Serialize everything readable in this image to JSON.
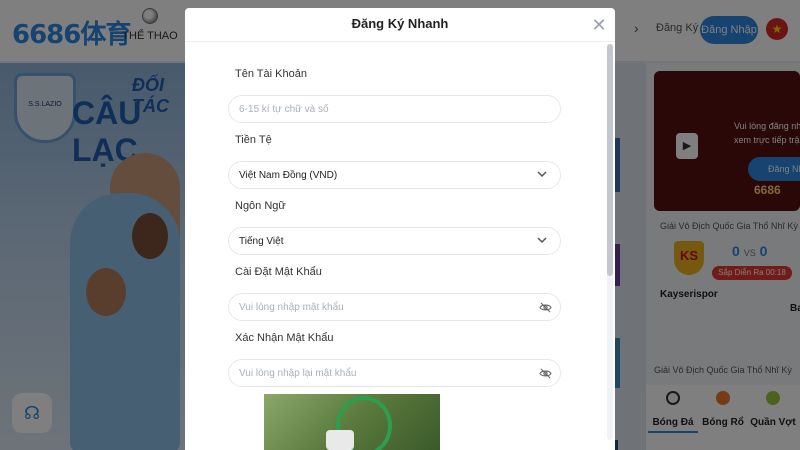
{
  "header": {
    "logo": "6686体育",
    "nav_sports": "THỂ THAO",
    "register": "Đăng Ký",
    "login": "Đăng Nhập",
    "flag_symbol": "★"
  },
  "hero": {
    "crest_label": "S.S.LAZIO",
    "title_line1": "ĐỐI TÁC",
    "title_line2": "CÂU LẠC"
  },
  "right_panel": {
    "promo_message": "Vui lòng đăng nhập xem trực tiếp trận",
    "promo_button": "Đăng Nhập",
    "promo_logo": "6686",
    "league": "Giải Vô Địch Quốc Gia Thổ Nhĩ Kỳ",
    "home_logo": "KS",
    "home_score": "0",
    "vs": "VS",
    "away_score": "0",
    "live_badge": "Sắp Diễn Ra 00:18",
    "home_team": "Kayserispor",
    "away_team": "Ba",
    "league2": "Giải Vô Địch Quốc Gia Thổ Nhĩ Kỳ",
    "tabs": [
      {
        "label": "Bóng Đá",
        "color": "#f4f4f4"
      },
      {
        "label": "Bóng Rổ",
        "color": "#e8782a"
      },
      {
        "label": "Quần Vợt",
        "color": "#9bc53d"
      }
    ]
  },
  "modal": {
    "title": "Đăng Ký Nhanh",
    "close": "✕",
    "fields": {
      "username": {
        "label": "Tên Tài Khoản",
        "placeholder": "6-15 kí tự chữ và số"
      },
      "currency": {
        "label": "Tiền Tệ",
        "value": "Việt Nam Đồng (VND)"
      },
      "language": {
        "label": "Ngôn Ngữ",
        "value": "Tiếng Việt"
      },
      "password": {
        "label": "Cài Đặt Mật Khẩu",
        "placeholder": "Vui lòng nhập mật khẩu"
      },
      "confirm": {
        "label": "Xác Nhận Mật Khẩu",
        "placeholder": "Vui lòng nhập lại mật khẩu"
      }
    }
  },
  "colors": {
    "accent": "#2e86e0",
    "live": "#e53935",
    "overlay": "rgba(0,0,0,0.5)"
  }
}
